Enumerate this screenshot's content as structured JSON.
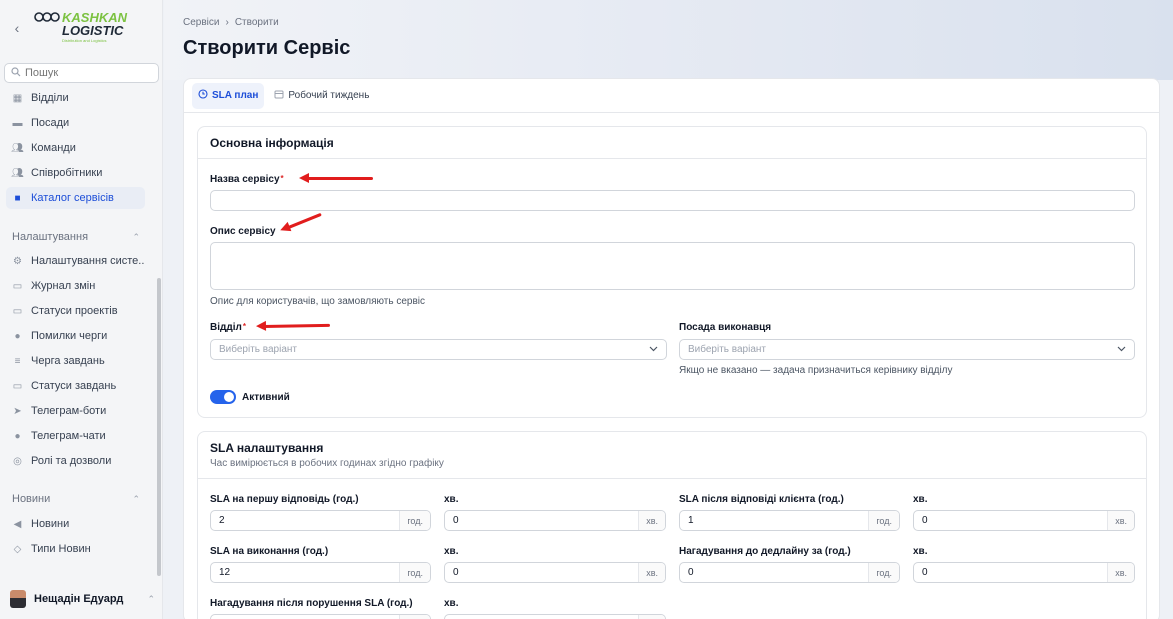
{
  "app": {
    "logo_main": "KASHKAN",
    "logo_sub": "LOGISTIC",
    "logo_tagline": "Distribution and Logistics"
  },
  "sidebar": {
    "search_placeholder": "Пошук",
    "items": [
      {
        "label": "Відділи",
        "icon": "building-icon"
      },
      {
        "label": "Посади",
        "icon": "briefcase-icon"
      },
      {
        "label": "Команди",
        "icon": "users-icon"
      },
      {
        "label": "Співробітники",
        "icon": "users-icon"
      },
      {
        "label": "Каталог сервісів",
        "icon": "book-icon"
      }
    ],
    "settings_section": "Налаштування",
    "settings_items": [
      {
        "label": "Налаштування систе...",
        "icon": "gear-icon"
      },
      {
        "label": "Журнал змін",
        "icon": "folder-icon"
      },
      {
        "label": "Статуси проектів",
        "icon": "folder-icon"
      },
      {
        "label": "Помилки черги",
        "icon": "alert-icon"
      },
      {
        "label": "Черга завдань",
        "icon": "list-icon"
      },
      {
        "label": "Статуси завдань",
        "icon": "folder-icon"
      },
      {
        "label": "Телеграм-боти",
        "icon": "send-icon"
      },
      {
        "label": "Телеграм-чати",
        "icon": "chat-icon"
      },
      {
        "label": "Ролі та дозволи",
        "icon": "shield-icon"
      }
    ],
    "news_section": "Новини",
    "news_items": [
      {
        "label": "Новини",
        "icon": "megaphone-icon"
      },
      {
        "label": "Типи Новин",
        "icon": "tag-icon"
      }
    ],
    "user_name": "Нещадін Едуард"
  },
  "header": {
    "breadcrumb": [
      "Сервіси",
      "Створити"
    ],
    "title": "Створити Сервіс"
  },
  "tabs": [
    {
      "label": "SLA план",
      "icon": "clock-icon",
      "active": true
    },
    {
      "label": "Робочий тиждень",
      "icon": "calendar-icon",
      "active": false
    }
  ],
  "basic": {
    "title": "Основна інформація",
    "name_label": "Назва сервісу",
    "name_value": "",
    "desc_label": "Опис сервісу",
    "desc_value": "",
    "desc_help": "Опис для користувачів, що замовляють сервіс",
    "dept_label": "Відділ",
    "dept_placeholder": "Виберіть варіант",
    "position_label": "Посада виконавця",
    "position_placeholder": "Виберіть варіант",
    "position_help": "Якщо не вказано — задача призначиться керівнику відділу",
    "active_label": "Активний",
    "active": true
  },
  "sla": {
    "title": "SLA налаштування",
    "subtitle": "Час вимірюється в робочих годинах згідно графіку",
    "hours_unit": "год.",
    "min_unit": "хв.",
    "min_label": "хв.",
    "first_response_label": "SLA на першу відповідь (год.)",
    "first_response_hours": "2",
    "first_response_min": "0",
    "after_client_label": "SLA після відповіді клієнта (год.)",
    "after_client_hours": "1",
    "after_client_min": "0",
    "resolution_label": "SLA на виконання (год.)",
    "resolution_hours": "12",
    "resolution_min": "0",
    "reminder_label": "Нагадування до дедлайну за (год.)",
    "reminder_hours": "0",
    "reminder_min": "0",
    "breach_label": "Нагадування після порушення SLA (год.)"
  },
  "colors": {
    "accent": "#1d4ed8",
    "toggle": "#2563eb",
    "annotation_arrow": "#e11d1d"
  }
}
